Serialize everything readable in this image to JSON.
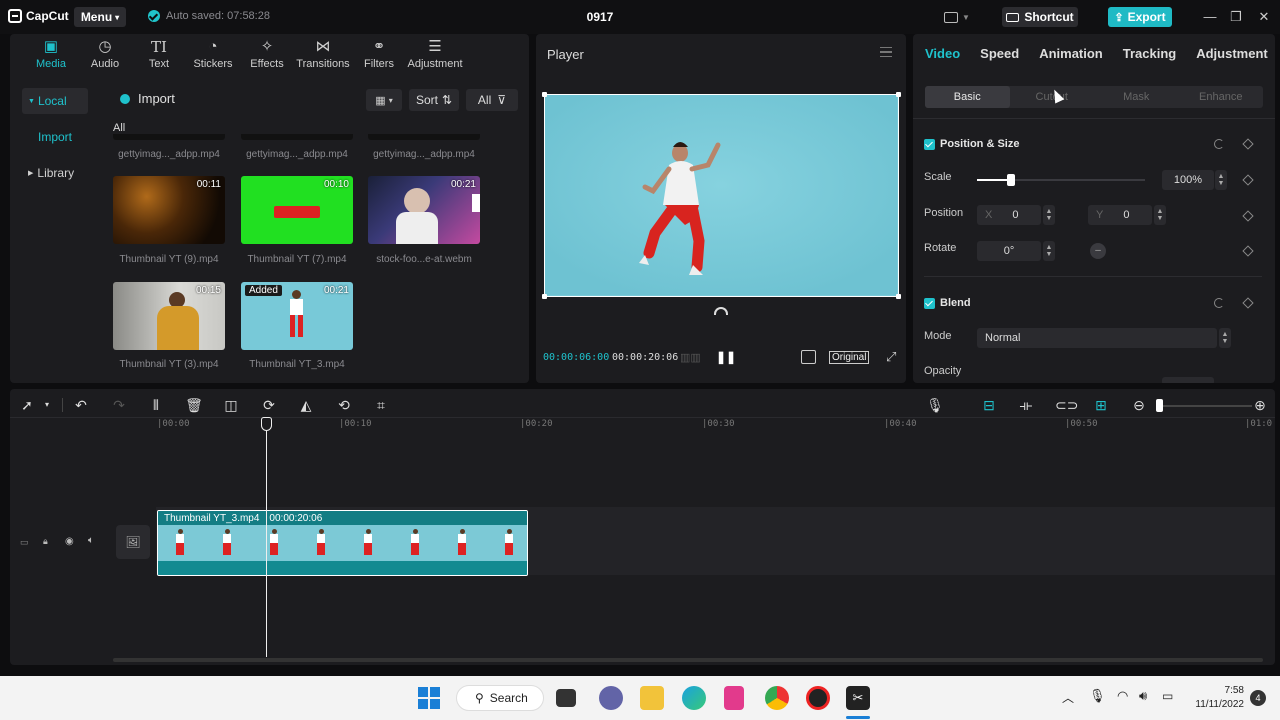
{
  "titlebar": {
    "app_name": "CapCut",
    "menu_label": "Menu",
    "autosave": "Auto saved: 07:58:28",
    "project_title": "0917",
    "shortcut_label": "Shortcut",
    "export_label": "Export",
    "window_controls": [
      "minimize-icon",
      "restore-icon",
      "close-icon"
    ]
  },
  "media": {
    "tabs": [
      {
        "label": "Media",
        "icon": "media-icon",
        "active": true
      },
      {
        "label": "Audio",
        "icon": "audio-icon"
      },
      {
        "label": "Text",
        "icon": "text-icon"
      },
      {
        "label": "Stickers",
        "icon": "stickers-icon"
      },
      {
        "label": "Effects",
        "icon": "effects-icon"
      },
      {
        "label": "Transitions",
        "icon": "transitions-icon"
      },
      {
        "label": "Filters",
        "icon": "filters-icon"
      },
      {
        "label": "Adjustment",
        "icon": "adjustment-icon"
      }
    ],
    "side_nav": {
      "local": "Local",
      "import": "Import",
      "library": "Library"
    },
    "import_label": "Import",
    "sort_label": "Sort",
    "filter_label": "All",
    "section_label": "All",
    "top_row_names": [
      "gettyimag..._adpp.mp4",
      "gettyimag..._adpp.mp4",
      "gettyimag..._adpp.mp4"
    ],
    "clips": [
      {
        "name": "Thumbnail YT (9).mp4",
        "duration": "00:11"
      },
      {
        "name": "Thumbnail YT (7).mp4",
        "duration": "00:10"
      },
      {
        "name": "stock-foo...e-at.webm",
        "duration": "00:21"
      },
      {
        "name": "Thumbnail YT (3).mp4",
        "duration": "00:15"
      },
      {
        "name": "Thumbnail YT_3.mp4",
        "duration": "00:21",
        "badge": "Added"
      }
    ]
  },
  "player": {
    "title": "Player",
    "current_time": "00:00:06:00",
    "total_time": "00:00:20:06",
    "ratio_label": "Original"
  },
  "props": {
    "tabs": [
      "Video",
      "Speed",
      "Animation",
      "Tracking",
      "Adjustment"
    ],
    "active_tab": "Video",
    "subtabs": [
      "Basic",
      "Cutout",
      "Mask",
      "Enhance"
    ],
    "position_size": {
      "title": "Position & Size",
      "scale_label": "Scale",
      "scale_value": "100%",
      "scale_fraction": 0.2,
      "position_label": "Position",
      "x_label": "X",
      "x_value": "0",
      "y_label": "Y",
      "y_value": "0",
      "rotate_label": "Rotate",
      "rotate_value": "0°"
    },
    "blend": {
      "title": "Blend",
      "mode_label": "Mode",
      "mode_value": "Normal",
      "opacity_label": "Opacity"
    }
  },
  "timeline": {
    "ruler": [
      "|00:00",
      "|00:10",
      "|00:20",
      "|00:30",
      "|00:40",
      "|00:50",
      "|01:0"
    ],
    "clip_name": "Thumbnail YT_3.mp4",
    "clip_duration": "00:00:20:06"
  },
  "taskbar": {
    "search_label": "Search",
    "time": "7:58",
    "date": "11/11/2022",
    "notification_count": "4"
  },
  "colors": {
    "accent": "#1fc2cc",
    "panel": "#1c1c1f",
    "video_bg": "#78c9d8"
  }
}
